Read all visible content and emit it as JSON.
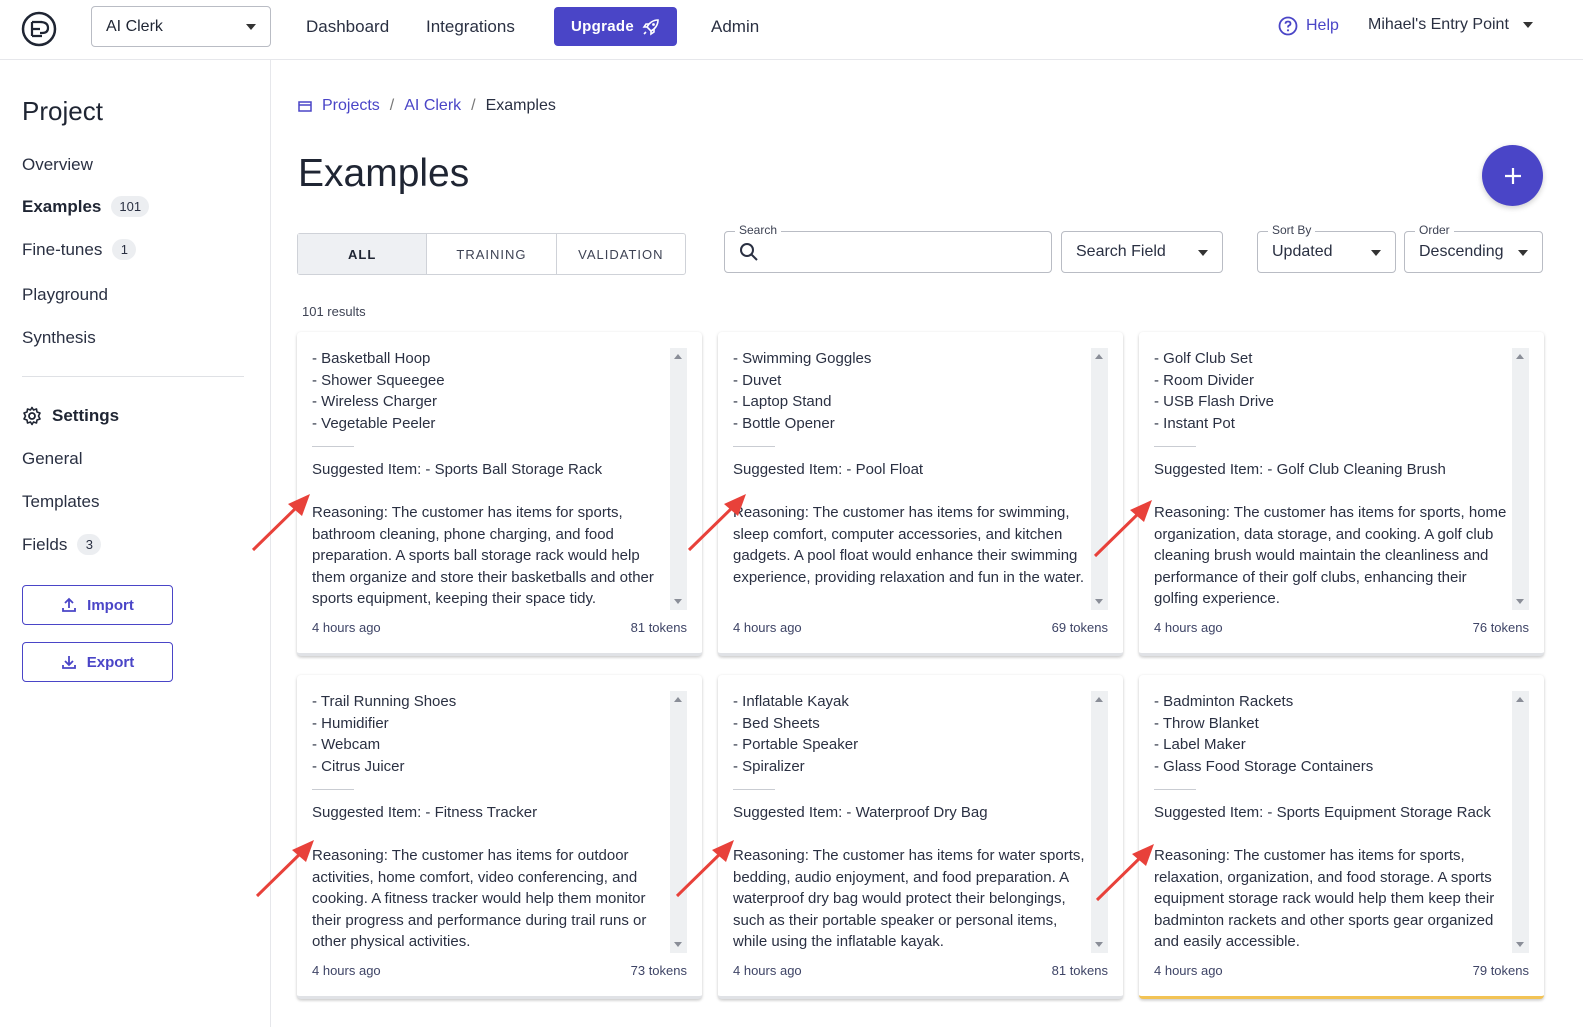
{
  "header": {
    "project_select": "AI Clerk",
    "nav": [
      "Dashboard",
      "Integrations"
    ],
    "upgrade_label": "Upgrade",
    "admin_label": "Admin",
    "help_label": "Help",
    "user_label": "Mihael's Entry Point"
  },
  "sidebar": {
    "title": "Project",
    "items": [
      {
        "label": "Overview"
      },
      {
        "label": "Examples",
        "count": "101"
      },
      {
        "label": "Fine-tunes",
        "count": "1"
      },
      {
        "label": "Playground"
      },
      {
        "label": "Synthesis"
      }
    ],
    "settings_label": "Settings",
    "settings_items": [
      {
        "label": "General"
      },
      {
        "label": "Templates"
      },
      {
        "label": "Fields",
        "count": "3"
      }
    ],
    "import_label": "Import",
    "export_label": "Export"
  },
  "breadcrumb": {
    "root": "Projects",
    "project": "AI Clerk",
    "current": "Examples"
  },
  "page_title": "Examples",
  "tabs": [
    "ALL",
    "TRAINING",
    "VALIDATION"
  ],
  "filters": {
    "search_label": "Search",
    "search_value": "",
    "search_field": "Search Field",
    "sort_label": "Sort By",
    "sort_value": "Updated",
    "order_label": "Order",
    "order_value": "Descending"
  },
  "results_text": "101 results",
  "cards": [
    {
      "items": [
        "- Basketball Hoop",
        "- Shower Squeegee",
        "- Wireless Charger",
        "- Vegetable Peeler"
      ],
      "suggested": "Suggested Item: - Sports Ball Storage Rack",
      "reasoning": "Reasoning: The customer has items for sports, bathroom cleaning, phone charging, and food preparation. A sports ball storage rack would help them organize and store their basketballs and other sports equipment, keeping their space tidy.",
      "time": "4 hours ago",
      "tokens": "81 tokens"
    },
    {
      "items": [
        "- Swimming Goggles",
        "- Duvet",
        "- Laptop Stand",
        "- Bottle Opener"
      ],
      "suggested": "Suggested Item: - Pool Float",
      "reasoning": "Reasoning: The customer has items for swimming, sleep comfort, computer accessories, and kitchen gadgets. A pool float would enhance their swimming experience, providing relaxation and fun in the water.",
      "time": "4 hours ago",
      "tokens": "69 tokens"
    },
    {
      "items": [
        "- Golf Club Set",
        "- Room Divider",
        "- USB Flash Drive",
        "- Instant Pot"
      ],
      "suggested": "Suggested Item: - Golf Club Cleaning Brush",
      "reasoning": "Reasoning: The customer has items for sports, home organization, data storage, and cooking. A golf club cleaning brush would maintain the cleanliness and performance of their golf clubs, enhancing their golfing experience.",
      "time": "4 hours ago",
      "tokens": "76 tokens"
    },
    {
      "items": [
        "- Trail Running Shoes",
        "- Humidifier",
        "- Webcam",
        "- Citrus Juicer"
      ],
      "suggested": "Suggested Item: - Fitness Tracker",
      "reasoning": "Reasoning: The customer has items for outdoor activities, home comfort, video conferencing, and cooking. A fitness tracker would help them monitor their progress and performance during trail runs or other physical activities.",
      "time": "4 hours ago",
      "tokens": "73 tokens"
    },
    {
      "items": [
        "- Inflatable Kayak",
        "- Bed Sheets",
        "- Portable Speaker",
        "- Spiralizer"
      ],
      "suggested": "Suggested Item: - Waterproof Dry Bag",
      "reasoning": "Reasoning: The customer has items for water sports, bedding, audio enjoyment, and food preparation. A waterproof dry bag would protect their belongings, such as their portable speaker or personal items, while using the inflatable kayak.",
      "time": "4 hours ago",
      "tokens": "81 tokens"
    },
    {
      "items": [
        "- Badminton Rackets",
        "- Throw Blanket",
        "- Label Maker",
        "- Glass Food Storage Containers"
      ],
      "suggested": "Suggested Item: - Sports Equipment Storage Rack",
      "reasoning": "Reasoning: The customer has items for sports, relaxation, organization, and food storage. A sports equipment storage rack would help them keep their badminton rackets and other sports gear organized and easily accessible.",
      "time": "4 hours ago",
      "tokens": "79 tokens"
    }
  ],
  "colors": {
    "accent": "#4a45c7",
    "annotation_arrow": "#e8413a",
    "highlight_border": "#f2c355"
  },
  "icons": {
    "logo": "ep-logo-icon",
    "upgrade": "rocket-icon",
    "help": "help-circle-icon",
    "settings": "gear-icon",
    "search": "search-icon",
    "import": "upload-icon",
    "export": "download-icon",
    "breadcrumb": "folder-icon",
    "add": "plus-icon"
  }
}
